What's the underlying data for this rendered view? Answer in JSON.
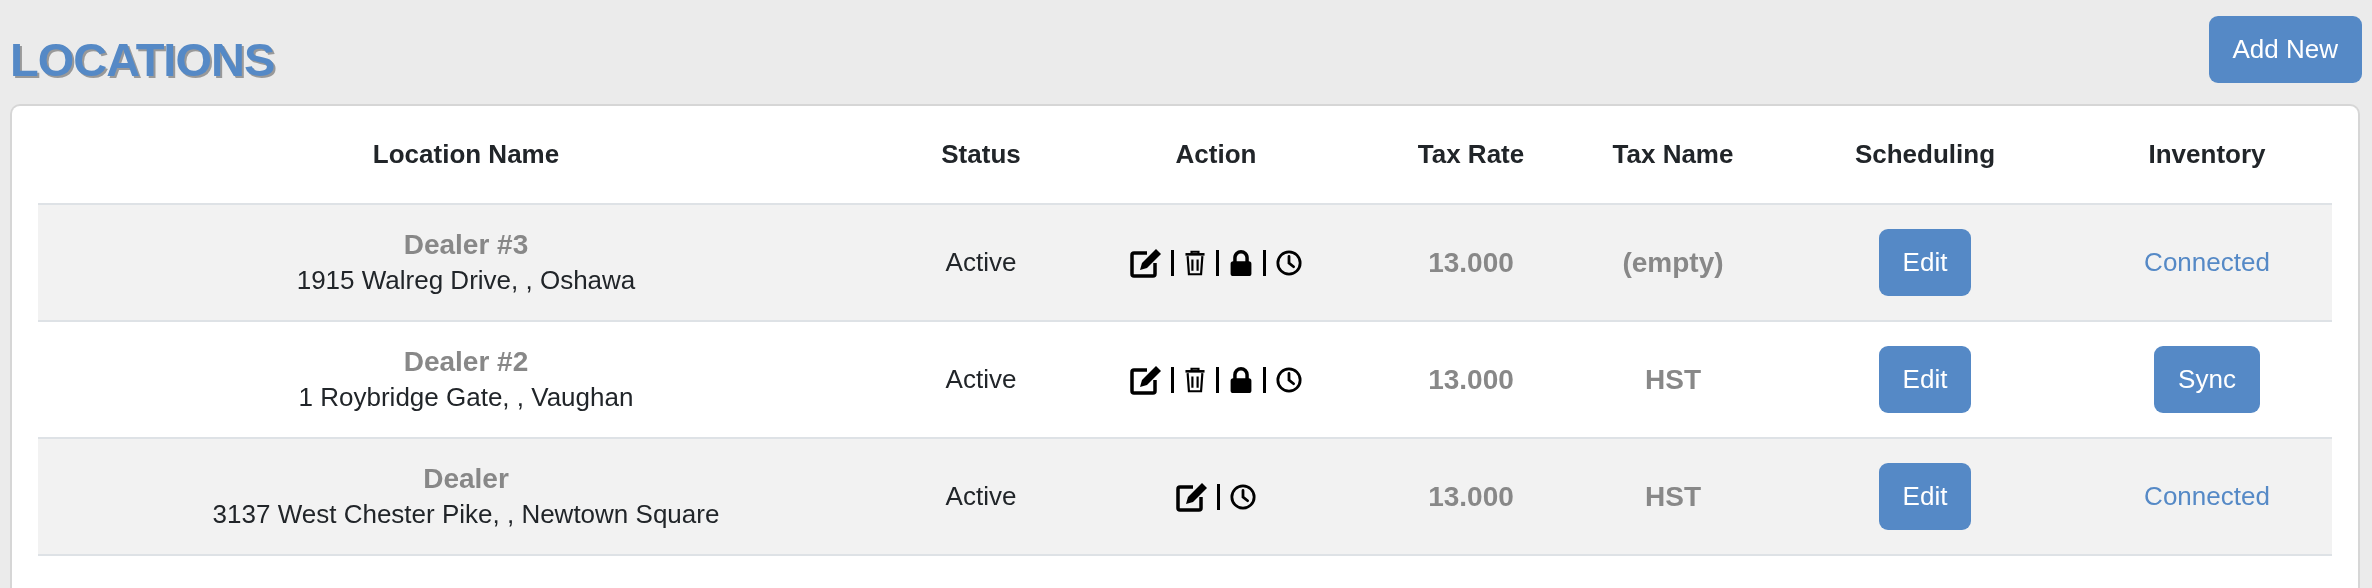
{
  "page": {
    "title": "LOCATIONS",
    "add_button": "Add New"
  },
  "table": {
    "columns": [
      "Location Name",
      "Status",
      "Action",
      "Tax Rate",
      "Tax Name",
      "Scheduling",
      "Inventory"
    ],
    "rows": [
      {
        "name": "Dealer #3",
        "address": "1915 Walreg Drive, , Oshawa",
        "status": "Active",
        "actions": [
          {
            "kind": "edit"
          },
          {
            "kind": "delete"
          },
          {
            "kind": "lock"
          },
          {
            "kind": "schedule"
          }
        ],
        "tax_rate": "13.000",
        "tax_name": "(empty)",
        "scheduling": "Edit",
        "inventory": {
          "kind": "link",
          "label": "Connected"
        }
      },
      {
        "name": "Dealer #2",
        "address": "1 Roybridge Gate, , Vaughan",
        "status": "Active",
        "actions": [
          {
            "kind": "edit"
          },
          {
            "kind": "delete"
          },
          {
            "kind": "lock"
          },
          {
            "kind": "schedule"
          }
        ],
        "tax_rate": "13.000",
        "tax_name": "HST",
        "scheduling": "Edit",
        "inventory": {
          "kind": "button",
          "label": "Sync"
        }
      },
      {
        "name": "Dealer",
        "address": "3137 West Chester Pike, , Newtown Square",
        "status": "Active",
        "actions": [
          {
            "kind": "edit"
          },
          {
            "kind": "schedule"
          }
        ],
        "tax_rate": "13.000",
        "tax_name": "HST",
        "scheduling": "Edit",
        "inventory": {
          "kind": "link",
          "label": "Connected"
        }
      }
    ]
  }
}
